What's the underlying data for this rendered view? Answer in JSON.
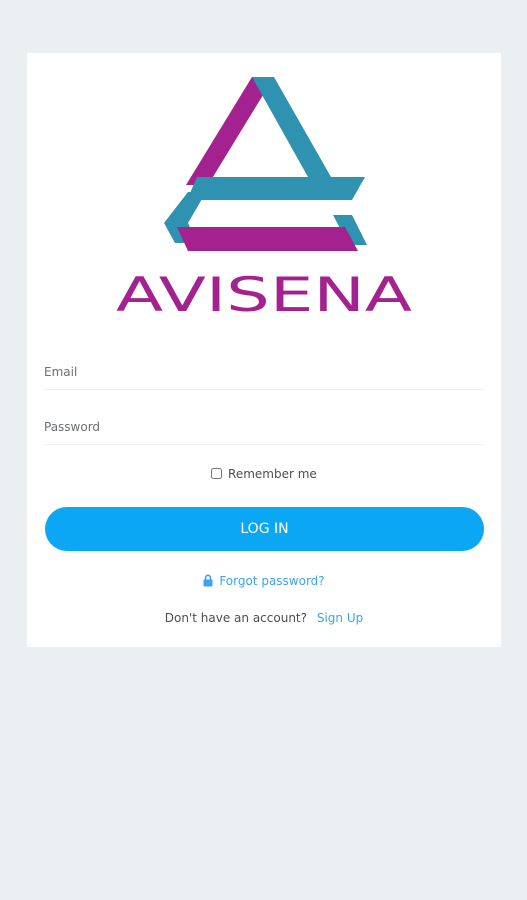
{
  "brand": {
    "name": "AVISENA",
    "colors": {
      "purple": "#a3228f",
      "teal": "#2e92b0",
      "accent": "#0ca7f4",
      "link": "#3ba4ee",
      "background": "#ebeff2"
    }
  },
  "form": {
    "email_placeholder": "Email",
    "password_placeholder": "Password",
    "remember_label": "Remember me",
    "login_label": "LOG IN",
    "forgot_label": "Forgot password?",
    "forgot_icon": "lock-icon",
    "no_account_text": "Don't have an account?",
    "signup_label": "Sign Up"
  }
}
